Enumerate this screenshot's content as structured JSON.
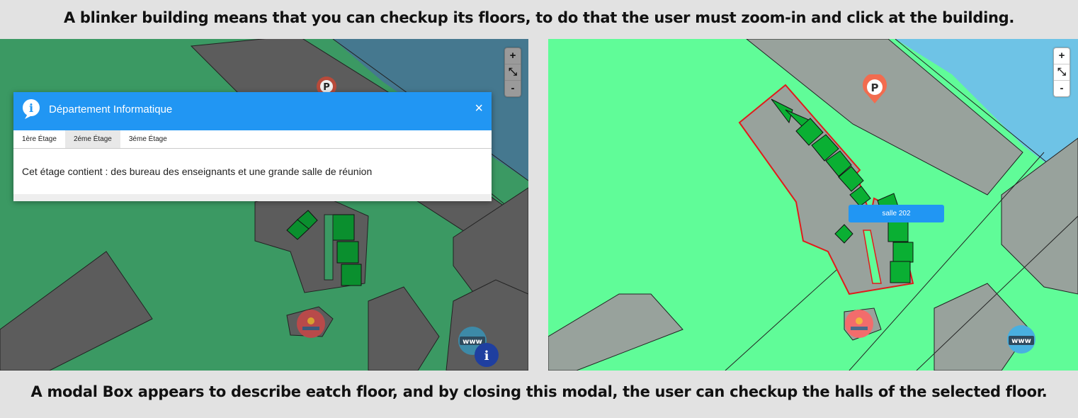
{
  "captions": {
    "top": "A blinker building means that you can checkup its floors, to do that the user must zoom-in and click at the building.",
    "bottom": "A modal Box appears to describe eatch floor, and by closing this modal, the user can checkup the halls of the selected floor."
  },
  "zoom_controls": {
    "zoom_in": "+",
    "reset": "⤡",
    "zoom_out": "-"
  },
  "modal": {
    "title": "Département Informatique",
    "close": "×",
    "tabs": [
      "1ère Étage",
      "2éme Étage",
      "3éme Étage"
    ],
    "active_tab": 1,
    "content": "Cet étage contient : des bureau des enseignants et une grande salle de réunion"
  },
  "markers": {
    "parking": "P",
    "www": "www",
    "info": "i"
  },
  "hall_label": "salle 202",
  "colors": {
    "left_ground": "#3b9963",
    "left_water": "#45788f",
    "right_ground": "#60fc98",
    "right_water": "#6ec3e6",
    "building_dark": "#5c5c5c",
    "building_light": "#98a29c",
    "hall_green": "#0aaf33",
    "modal_header": "#2196f3",
    "outline_red": "#e11b1b"
  }
}
